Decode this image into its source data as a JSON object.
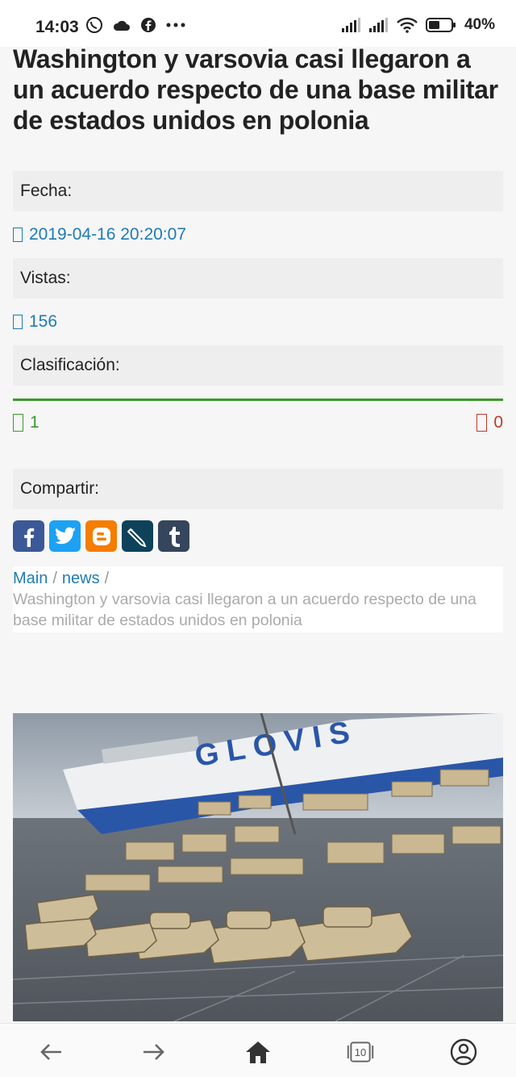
{
  "status_bar": {
    "time": "14:03",
    "battery": "40%",
    "icons_left": [
      "viber-icon",
      "cloud-icon",
      "facebook-icon",
      "more-icon"
    ],
    "icons_right": [
      "signal-icon",
      "signal-icon",
      "wifi-icon",
      "battery-icon"
    ]
  },
  "article": {
    "title": "Washington y varsovia casi llegaron a un acuerdo respecto de una base militar de estados unidos en polonia",
    "date_label": "Fecha:",
    "date_value": "2019-04-16 20:20:07",
    "views_label": "Vistas:",
    "views_value": "156",
    "rating_label": "Clasificación:",
    "votes_up": "1",
    "votes_down": "0",
    "share_label": "Compartir:"
  },
  "share": [
    {
      "name": "facebook",
      "color": "#3b5998"
    },
    {
      "name": "twitter",
      "color": "#1da1f2"
    },
    {
      "name": "blogger",
      "color": "#f57d00"
    },
    {
      "name": "livejournal",
      "color": "#0d425a"
    },
    {
      "name": "tumblr",
      "color": "#35465c"
    }
  ],
  "breadcrumb": {
    "main": "Main",
    "news": "news",
    "current": "Washington y varsovia casi llegaron a un acuerdo respecto de una base militar de estados unidos en polonia",
    "separator": "/"
  },
  "photo": {
    "ship_text": "GLOVIS"
  },
  "nav": {
    "tab_count": "10",
    "items": [
      "back-icon",
      "forward-icon",
      "home-icon",
      "tabs-icon",
      "profile-icon"
    ]
  }
}
